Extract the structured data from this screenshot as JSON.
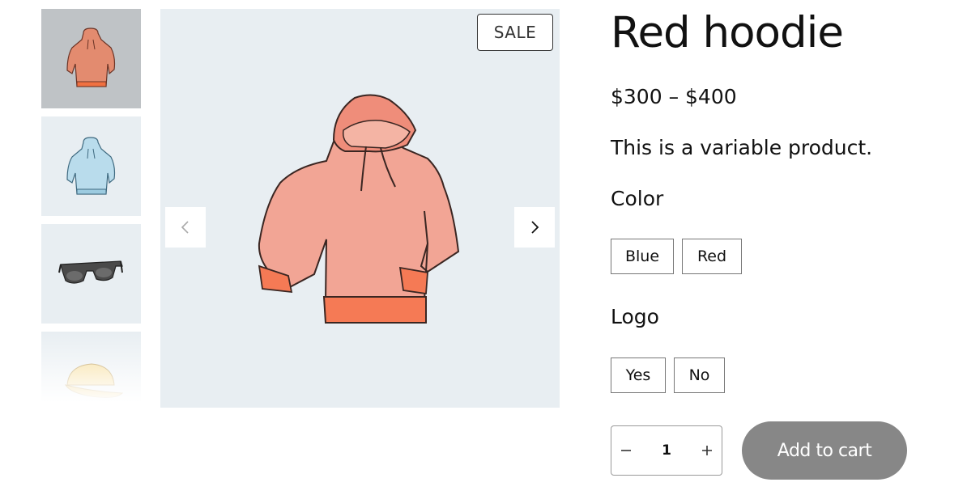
{
  "gallery": {
    "sale_badge": "SALE",
    "thumbnails": [
      {
        "name": "red hoodie",
        "icon": "hoodie-icon",
        "color": "#e38b6f"
      },
      {
        "name": "blue hoodie",
        "icon": "hoodie-icon",
        "color": "#a9d4e8"
      },
      {
        "name": "sunglasses",
        "icon": "sunglasses-icon",
        "color": "#555555"
      },
      {
        "name": "cap",
        "icon": "cap-icon",
        "color": "#f5d88c"
      }
    ],
    "prev_icon": "chevron-left-icon",
    "next_icon": "chevron-right-icon"
  },
  "product": {
    "title": "Red hoodie",
    "price": "$300 – $400",
    "description": "This is a variable product."
  },
  "attributes": {
    "color": {
      "label": "Color",
      "options": [
        "Blue",
        "Red"
      ]
    },
    "logo": {
      "label": "Logo",
      "options": [
        "Yes",
        "No"
      ]
    }
  },
  "cart": {
    "quantity": "1",
    "minus_icon": "minus-icon",
    "plus_icon": "plus-icon",
    "add_label": "Add to cart",
    "button_color": "#878787"
  }
}
